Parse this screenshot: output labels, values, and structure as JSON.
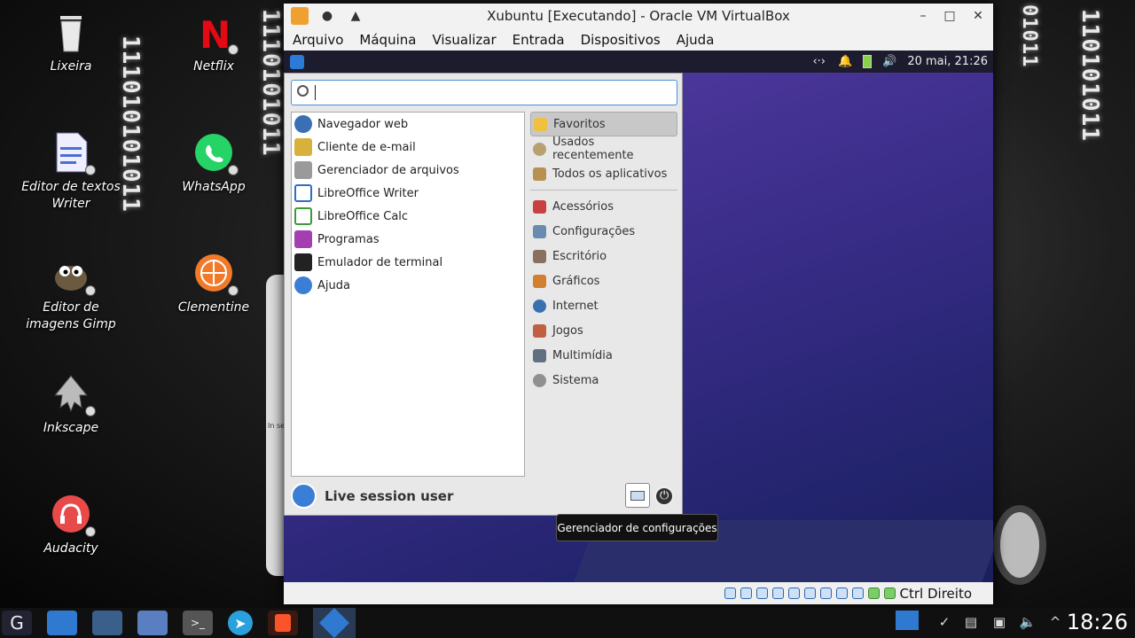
{
  "desktop": {
    "binary_left": "111010101011",
    "binary_mid": "1110101011",
    "binary_right": "110101011",
    "binary_far": "01011",
    "icons": [
      {
        "label": "Lixeira",
        "icon": "trash-icon"
      },
      {
        "label": "Netflix",
        "icon": "netflix-icon"
      },
      {
        "label": "Editor de textos Writer",
        "icon": "writer-icon"
      },
      {
        "label": "WhatsApp",
        "icon": "whatsapp-icon"
      },
      {
        "label": "Editor de imagens Gimp",
        "icon": "gimp-icon"
      },
      {
        "label": "Clementine",
        "icon": "clementine-icon"
      },
      {
        "label": "Inkscape",
        "icon": "inkscape-icon"
      },
      {
        "label": "Audacity",
        "icon": "audacity-icon"
      }
    ],
    "doc_snippet": "In se"
  },
  "vm_window": {
    "title": "Xubuntu [Executando] - Oracle VM VirtualBox",
    "menu": [
      "Arquivo",
      "Máquina",
      "Visualizar",
      "Entrada",
      "Dispositivos",
      "Ajuda"
    ],
    "status_host_key": "Ctrl Direito"
  },
  "guest_panel": {
    "datetime": "20 mai, 21:26"
  },
  "whisker": {
    "search_value": "",
    "apps": [
      {
        "label": "Navegador web",
        "color": "#3a6fb5"
      },
      {
        "label": "Cliente de e-mail",
        "color": "#d8b13c"
      },
      {
        "label": "Gerenciador de arquivos",
        "color": "#9a9a9a"
      },
      {
        "label": "LibreOffice Writer",
        "color": "#2c6fc8"
      },
      {
        "label": "LibreOffice Calc",
        "color": "#3b9b3b"
      },
      {
        "label": "Programas",
        "color": "#a33fb0"
      },
      {
        "label": "Emulador de terminal",
        "color": "#222222"
      },
      {
        "label": "Ajuda",
        "color": "#3a7fd5"
      }
    ],
    "categories_top": [
      {
        "label": "Favoritos",
        "color": "#f0c040"
      },
      {
        "label": "Usados recentemente",
        "color": "#b8a070"
      },
      {
        "label": "Todos os aplicativos",
        "color": "#b89050"
      }
    ],
    "categories": [
      {
        "label": "Acessórios",
        "color": "#c84040"
      },
      {
        "label": "Configurações",
        "color": "#6a8bb0"
      },
      {
        "label": "Escritório",
        "color": "#8a7060"
      },
      {
        "label": "Gráficos",
        "color": "#d08030"
      },
      {
        "label": "Internet",
        "color": "#3a70b0"
      },
      {
        "label": "Jogos",
        "color": "#c06040"
      },
      {
        "label": "Multimídia",
        "color": "#607080"
      },
      {
        "label": "Sistema",
        "color": "#909090"
      }
    ],
    "user": "Live session user"
  },
  "tooltip": "Gerenciador de configurações",
  "host_panel": {
    "clock": "18:26"
  }
}
